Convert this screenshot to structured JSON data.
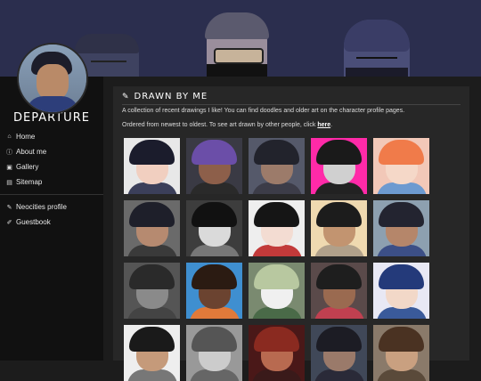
{
  "site": {
    "title": "DEPARTURE"
  },
  "nav": {
    "items": [
      {
        "label": "Home",
        "icon": "home-icon",
        "glyph": "⌂"
      },
      {
        "label": "About me",
        "icon": "info-icon",
        "glyph": "ⓘ"
      },
      {
        "label": "Gallery",
        "icon": "image-icon",
        "glyph": "▣"
      },
      {
        "label": "Sitemap",
        "icon": "map-icon",
        "glyph": "▤"
      }
    ],
    "links": [
      {
        "label": "Neocities profile",
        "icon": "cat-icon",
        "glyph": "✎"
      },
      {
        "label": "Guestbook",
        "icon": "feather-icon",
        "glyph": "✐"
      }
    ]
  },
  "main": {
    "heading": "DRAWN BY ME",
    "heading_icon": "brush-icon",
    "intro": "A collection of recent drawings I like! You can find doodles and older art on the character profile pages.",
    "order_text": "Ordered from newest to oldest. To see art drawn by other people, click ",
    "order_link": "here",
    "order_end": "."
  },
  "gallery": [
    {
      "bg": "#e8e8e8",
      "hair": "#1b1c2c",
      "face": "#f1cfc0",
      "body": "#3b3f5a"
    },
    {
      "bg": "#3a3a44",
      "hair": "#6b4ea8",
      "face": "#8d5f4a",
      "body": "#2a2a2a"
    },
    {
      "bg": "#55596a",
      "hair": "#22232c",
      "face": "#9c7b6a",
      "body": "#3c3c48"
    },
    {
      "bg": "#ff2aa8",
      "hair": "#1a1a1a",
      "face": "#d0d0d0",
      "body": "#222"
    },
    {
      "bg": "#f2c8b8",
      "hair": "#f07b4a",
      "face": "#f5d8c8",
      "body": "#6d9ad0"
    },
    {
      "bg": "#6a6a6a",
      "hair": "#1e1f2a",
      "face": "#b68a70",
      "body": "#3a3a3a"
    },
    {
      "bg": "#3d3d3d",
      "hair": "#111",
      "face": "#dadada",
      "body": "#777"
    },
    {
      "bg": "#eeeeee",
      "hair": "#151515",
      "face": "#f3dcd2",
      "body": "#c23a3a"
    },
    {
      "bg": "#efd9b0",
      "hair": "#1c1c1c",
      "face": "#c29470",
      "body": "#b0a08a"
    },
    {
      "bg": "#8da0b0",
      "hair": "#232430",
      "face": "#b5866a",
      "body": "#3c4f86"
    },
    {
      "bg": "#555",
      "hair": "#2a2a2a",
      "face": "#8a8a8a",
      "body": "#444"
    },
    {
      "bg": "#3f8fd0",
      "hair": "#2b1b12",
      "face": "#6b4330",
      "body": "#e07a3a"
    },
    {
      "bg": "#7a8a70",
      "hair": "#b8c8a0",
      "face": "#f0f0f0",
      "body": "#4a6a48"
    },
    {
      "bg": "#5a4a4a",
      "hair": "#1e1e1e",
      "face": "#9a6a50",
      "body": "#c04050"
    },
    {
      "bg": "#e8e8f4",
      "hair": "#243a7a",
      "face": "#f2d8c8",
      "body": "#3a5a9a"
    },
    {
      "bg": "#eeeeee",
      "hair": "#1a1a1a",
      "face": "#c59a7a",
      "body": "#777"
    },
    {
      "bg": "#999",
      "hair": "#555",
      "face": "#ccc",
      "body": "#666"
    },
    {
      "bg": "#4a1818",
      "hair": "#8a2a20",
      "face": "#b86a50",
      "body": "#3a1a1a"
    },
    {
      "bg": "#404858",
      "hair": "#1c1c24",
      "face": "#9a7a6a",
      "body": "#2a2a38"
    },
    {
      "bg": "#8a7a6a",
      "hair": "#4a3222",
      "face": "#c9a080",
      "body": "#5a4a3a"
    }
  ]
}
